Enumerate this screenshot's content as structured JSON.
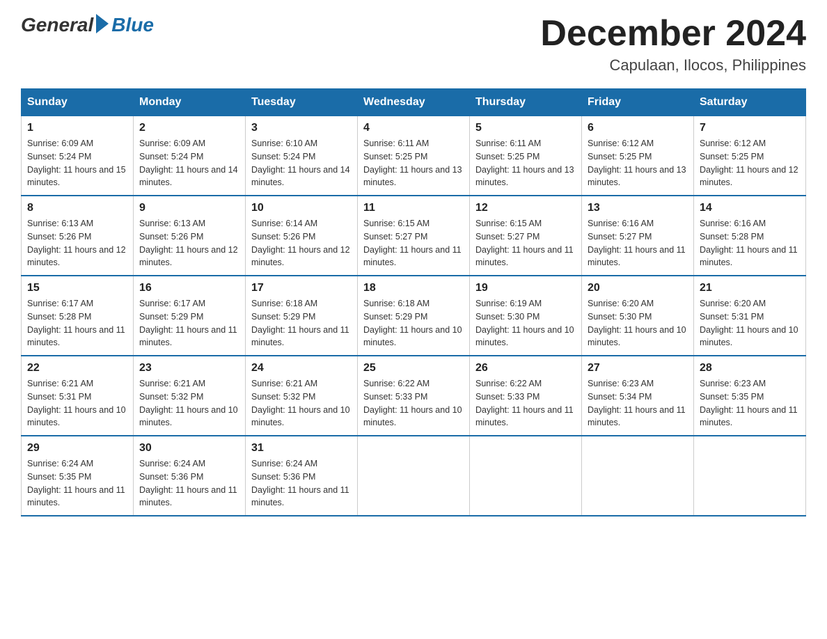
{
  "logo": {
    "general": "General",
    "blue": "Blue"
  },
  "title": "December 2024",
  "subtitle": "Capulaan, Ilocos, Philippines",
  "days_of_week": [
    "Sunday",
    "Monday",
    "Tuesday",
    "Wednesday",
    "Thursday",
    "Friday",
    "Saturday"
  ],
  "weeks": [
    [
      {
        "day": "1",
        "sunrise": "6:09 AM",
        "sunset": "5:24 PM",
        "daylight": "11 hours and 15 minutes."
      },
      {
        "day": "2",
        "sunrise": "6:09 AM",
        "sunset": "5:24 PM",
        "daylight": "11 hours and 14 minutes."
      },
      {
        "day": "3",
        "sunrise": "6:10 AM",
        "sunset": "5:24 PM",
        "daylight": "11 hours and 14 minutes."
      },
      {
        "day": "4",
        "sunrise": "6:11 AM",
        "sunset": "5:25 PM",
        "daylight": "11 hours and 13 minutes."
      },
      {
        "day": "5",
        "sunrise": "6:11 AM",
        "sunset": "5:25 PM",
        "daylight": "11 hours and 13 minutes."
      },
      {
        "day": "6",
        "sunrise": "6:12 AM",
        "sunset": "5:25 PM",
        "daylight": "11 hours and 13 minutes."
      },
      {
        "day": "7",
        "sunrise": "6:12 AM",
        "sunset": "5:25 PM",
        "daylight": "11 hours and 12 minutes."
      }
    ],
    [
      {
        "day": "8",
        "sunrise": "6:13 AM",
        "sunset": "5:26 PM",
        "daylight": "11 hours and 12 minutes."
      },
      {
        "day": "9",
        "sunrise": "6:13 AM",
        "sunset": "5:26 PM",
        "daylight": "11 hours and 12 minutes."
      },
      {
        "day": "10",
        "sunrise": "6:14 AM",
        "sunset": "5:26 PM",
        "daylight": "11 hours and 12 minutes."
      },
      {
        "day": "11",
        "sunrise": "6:15 AM",
        "sunset": "5:27 PM",
        "daylight": "11 hours and 11 minutes."
      },
      {
        "day": "12",
        "sunrise": "6:15 AM",
        "sunset": "5:27 PM",
        "daylight": "11 hours and 11 minutes."
      },
      {
        "day": "13",
        "sunrise": "6:16 AM",
        "sunset": "5:27 PM",
        "daylight": "11 hours and 11 minutes."
      },
      {
        "day": "14",
        "sunrise": "6:16 AM",
        "sunset": "5:28 PM",
        "daylight": "11 hours and 11 minutes."
      }
    ],
    [
      {
        "day": "15",
        "sunrise": "6:17 AM",
        "sunset": "5:28 PM",
        "daylight": "11 hours and 11 minutes."
      },
      {
        "day": "16",
        "sunrise": "6:17 AM",
        "sunset": "5:29 PM",
        "daylight": "11 hours and 11 minutes."
      },
      {
        "day": "17",
        "sunrise": "6:18 AM",
        "sunset": "5:29 PM",
        "daylight": "11 hours and 11 minutes."
      },
      {
        "day": "18",
        "sunrise": "6:18 AM",
        "sunset": "5:29 PM",
        "daylight": "11 hours and 10 minutes."
      },
      {
        "day": "19",
        "sunrise": "6:19 AM",
        "sunset": "5:30 PM",
        "daylight": "11 hours and 10 minutes."
      },
      {
        "day": "20",
        "sunrise": "6:20 AM",
        "sunset": "5:30 PM",
        "daylight": "11 hours and 10 minutes."
      },
      {
        "day": "21",
        "sunrise": "6:20 AM",
        "sunset": "5:31 PM",
        "daylight": "11 hours and 10 minutes."
      }
    ],
    [
      {
        "day": "22",
        "sunrise": "6:21 AM",
        "sunset": "5:31 PM",
        "daylight": "11 hours and 10 minutes."
      },
      {
        "day": "23",
        "sunrise": "6:21 AM",
        "sunset": "5:32 PM",
        "daylight": "11 hours and 10 minutes."
      },
      {
        "day": "24",
        "sunrise": "6:21 AM",
        "sunset": "5:32 PM",
        "daylight": "11 hours and 10 minutes."
      },
      {
        "day": "25",
        "sunrise": "6:22 AM",
        "sunset": "5:33 PM",
        "daylight": "11 hours and 10 minutes."
      },
      {
        "day": "26",
        "sunrise": "6:22 AM",
        "sunset": "5:33 PM",
        "daylight": "11 hours and 11 minutes."
      },
      {
        "day": "27",
        "sunrise": "6:23 AM",
        "sunset": "5:34 PM",
        "daylight": "11 hours and 11 minutes."
      },
      {
        "day": "28",
        "sunrise": "6:23 AM",
        "sunset": "5:35 PM",
        "daylight": "11 hours and 11 minutes."
      }
    ],
    [
      {
        "day": "29",
        "sunrise": "6:24 AM",
        "sunset": "5:35 PM",
        "daylight": "11 hours and 11 minutes."
      },
      {
        "day": "30",
        "sunrise": "6:24 AM",
        "sunset": "5:36 PM",
        "daylight": "11 hours and 11 minutes."
      },
      {
        "day": "31",
        "sunrise": "6:24 AM",
        "sunset": "5:36 PM",
        "daylight": "11 hours and 11 minutes."
      },
      null,
      null,
      null,
      null
    ]
  ]
}
